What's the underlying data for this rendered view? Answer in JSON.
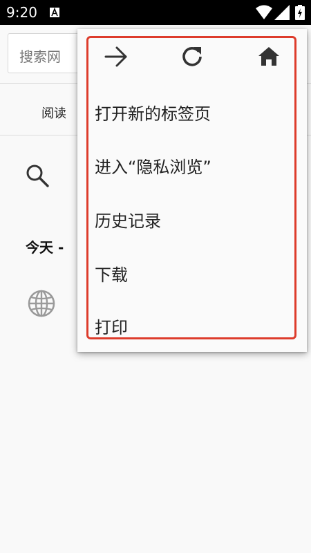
{
  "status_bar": {
    "time": "9:20"
  },
  "page": {
    "search_placeholder": "搜索网",
    "tab_reading": "阅读",
    "history_heading": "今天 -"
  },
  "menu": {
    "items": [
      {
        "label": "打开新的标签页"
      },
      {
        "label": "进入“隐私浏览”"
      },
      {
        "label": "历史记录"
      },
      {
        "label": "下载"
      },
      {
        "label": "打印"
      }
    ]
  },
  "colors": {
    "highlight": "#dd3b2b",
    "icon": "#333333"
  },
  "icons": [
    "forward-arrow-icon",
    "refresh-icon",
    "home-icon",
    "search-icon",
    "globe-icon"
  ]
}
